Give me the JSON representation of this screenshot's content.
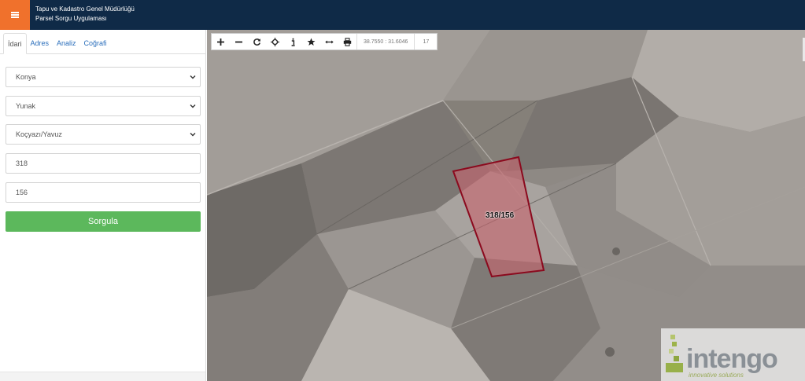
{
  "header": {
    "title_line1": "Tapu ve Kadastro Genel Müdürlüğü",
    "title_line2": "Parsel Sorgu Uygulaması"
  },
  "tabs": [
    {
      "label": "İdari",
      "active": true
    },
    {
      "label": "Adres",
      "active": false
    },
    {
      "label": "Analiz",
      "active": false
    },
    {
      "label": "Coğrafi",
      "active": false
    }
  ],
  "form": {
    "province": "Konya",
    "district": "Yunak",
    "neighborhood": "Koçyazı/Yavuz",
    "block": "318",
    "parcel": "156",
    "submit_label": "Sorgula"
  },
  "toolbar": {
    "icons": [
      "zoom-in-icon",
      "zoom-out-icon",
      "refresh-icon",
      "locate-icon",
      "info-icon",
      "star-icon",
      "measure-icon",
      "print-icon"
    ],
    "coordinates": "38.7550 : 31.6046",
    "zoom_level": "17"
  },
  "map": {
    "parcel_label": "318/156",
    "parcel_fill": "#c8646e",
    "parcel_stroke": "#8b0a1e"
  },
  "logo": {
    "word": "intengo",
    "tagline": "innovative solutions"
  },
  "colors": {
    "header_bg": "#0f2a47",
    "menu_button": "#f0712c",
    "submit_button": "#5cb85c",
    "tab_link": "#2a6ebb"
  }
}
